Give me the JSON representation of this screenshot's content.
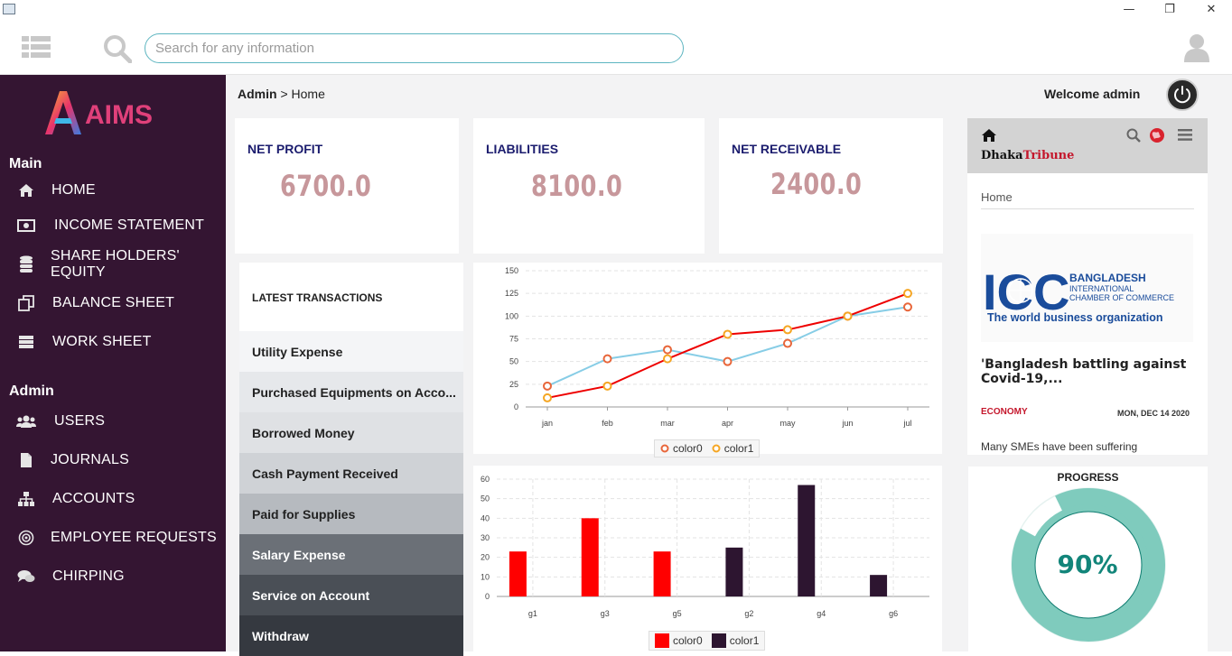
{
  "window": {
    "minimize": "—",
    "restore": "❐",
    "close": "✕"
  },
  "search": {
    "placeholder": "Search for any information"
  },
  "sidebar": {
    "logo_text": "AIMS",
    "sections": [
      {
        "label": "Main",
        "items": [
          {
            "label": "HOME",
            "icon": "home-icon"
          },
          {
            "label": "INCOME STATEMENT",
            "icon": "money-icon"
          },
          {
            "label": "SHARE HOLDERS' EQUITY",
            "icon": "database-icon"
          },
          {
            "label": "BALANCE SHEET",
            "icon": "copy-icon"
          },
          {
            "label": "WORK SHEET",
            "icon": "server-icon"
          }
        ]
      },
      {
        "label": "Admin",
        "items": [
          {
            "label": "USERS",
            "icon": "users-icon"
          },
          {
            "label": "JOURNALS",
            "icon": "file-icon"
          },
          {
            "label": "ACCOUNTS",
            "icon": "sitemap-icon"
          },
          {
            "label": "EMPLOYEE REQUESTS",
            "icon": "target-icon"
          },
          {
            "label": "CHIRPING",
            "icon": "chat-icon"
          }
        ]
      }
    ]
  },
  "header": {
    "breadcrumb_root": "Admin",
    "breadcrumb_sep": ">",
    "breadcrumb_current": "Home",
    "welcome": "Welcome admin"
  },
  "stats": [
    {
      "title": "NET PROFIT",
      "value": "6700.0"
    },
    {
      "title": "LIABILITIES",
      "value": "8100.0"
    },
    {
      "title": "NET RECEIVABLE",
      "value": "2400.0"
    }
  ],
  "transactions": {
    "heading": "LATEST TRANSACTIONS",
    "items": [
      {
        "label": "Utility Expense",
        "bg": "#f4f5f7",
        "fg": "#222222"
      },
      {
        "label": "Purchased Equipments on Acco...",
        "bg": "#e6e8eb",
        "fg": "#222222"
      },
      {
        "label": "Borrowed Money",
        "bg": "#dfe1e4",
        "fg": "#222222"
      },
      {
        "label": "Cash Payment Received",
        "bg": "#cfd2d6",
        "fg": "#222222"
      },
      {
        "label": "Paid for Supplies",
        "bg": "#b6babf",
        "fg": "#222222"
      },
      {
        "label": "Salary Expense",
        "bg": "#6b7077",
        "fg": "#ffffff"
      },
      {
        "label": "Service on Account",
        "bg": "#4a4f56",
        "fg": "#ffffff"
      },
      {
        "label": "Withdraw",
        "bg": "#353940",
        "fg": "#ffffff"
      }
    ]
  },
  "chart_data": [
    {
      "type": "line",
      "categories": [
        "jan",
        "feb",
        "mar",
        "apr",
        "may",
        "jun",
        "jul"
      ],
      "ylim": [
        0,
        150
      ],
      "yticks": [
        0,
        25,
        50,
        75,
        100,
        125,
        150
      ],
      "grid": true,
      "legend": "bottom",
      "series": [
        {
          "name": "color0",
          "values": [
            23,
            53,
            63,
            50,
            70,
            100,
            110
          ],
          "line_color": "#87cde6",
          "marker_color": "#e8663a"
        },
        {
          "name": "color1",
          "values": [
            10,
            23,
            53,
            80,
            85,
            100,
            125
          ],
          "line_color": "#ee0000",
          "marker_color": "#f5a623"
        }
      ]
    },
    {
      "type": "bar",
      "categories": [
        "g1",
        "g3",
        "g5",
        "g2",
        "g4",
        "g6"
      ],
      "ylim": [
        0,
        60
      ],
      "yticks": [
        0,
        10,
        20,
        30,
        40,
        50,
        60
      ],
      "grid": true,
      "legend": "bottom",
      "series": [
        {
          "name": "color0",
          "color": "#ff0000",
          "values": [
            23,
            40,
            23,
            null,
            null,
            null
          ]
        },
        {
          "name": "color1",
          "color": "#2d1530",
          "values": [
            null,
            null,
            null,
            25,
            57,
            11
          ]
        }
      ]
    }
  ],
  "news": {
    "brand_main": "Dhaka",
    "brand_accent": "Tribune",
    "nav_label": "Home",
    "image_org": "ICC",
    "image_line1": "BANGLADESH",
    "image_line2": "INTERNATIONAL",
    "image_line3": "CHAMBER OF COMMERCE",
    "image_tagline": "The world business organization",
    "headline": "'Bangladesh battling against Covid-19,...",
    "category": "ECONOMY",
    "date": "MON, DEC 14 2020",
    "snippet": "Many SMEs have been suffering"
  },
  "progress": {
    "title": "PROGRESS",
    "value_text": "90%",
    "fraction": 0.9
  },
  "colors": {
    "sidebar_bg": "#341532",
    "accent": "#12857a",
    "stat_value": "#c7979b",
    "stat_title": "#1b1c6e"
  }
}
